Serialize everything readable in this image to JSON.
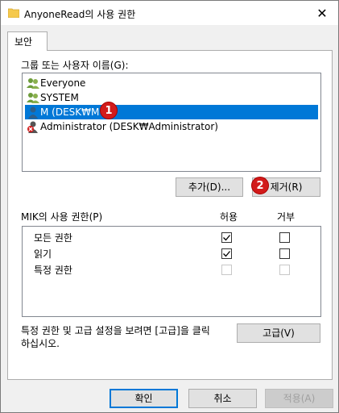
{
  "window": {
    "title": "AnyoneRead의 사용 권한",
    "close_glyph": "✕"
  },
  "tab": {
    "label": "보안"
  },
  "group_list": {
    "label": "그룹 또는 사용자 이름(G):",
    "items": [
      {
        "label": "Everyone",
        "icon": "group-users-icon",
        "selected": false
      },
      {
        "label": "SYSTEM",
        "icon": "group-users-icon",
        "selected": false
      },
      {
        "label": "M (DESK₩M",
        "icon": "user-icon",
        "selected": true
      },
      {
        "label": "Administrator (DESK₩Administrator)",
        "icon": "user-disabled-icon",
        "selected": false
      }
    ]
  },
  "buttons": {
    "add": "추가(D)...",
    "remove": "제거(R)",
    "advanced": "고급(V)",
    "ok": "확인",
    "cancel": "취소",
    "apply": "적용(A)"
  },
  "permissions": {
    "label": "MIK의 사용 권한(P)",
    "allow_header": "허용",
    "deny_header": "거부",
    "rows": [
      {
        "name": "모든 권한",
        "allow": true,
        "deny": false,
        "enabled": true
      },
      {
        "name": "읽기",
        "allow": true,
        "deny": false,
        "enabled": true
      },
      {
        "name": "특정 권한",
        "allow": false,
        "deny": false,
        "enabled": false
      }
    ]
  },
  "advanced_text": "특정 권한 및 고급 설정을 보려면 [고급]을 클릭\n하십시오.",
  "annotations": {
    "badge1": "1",
    "badge2": "2"
  },
  "colors": {
    "selection": "#0078d7",
    "badge": "#d21b1b",
    "check": "#000000"
  }
}
